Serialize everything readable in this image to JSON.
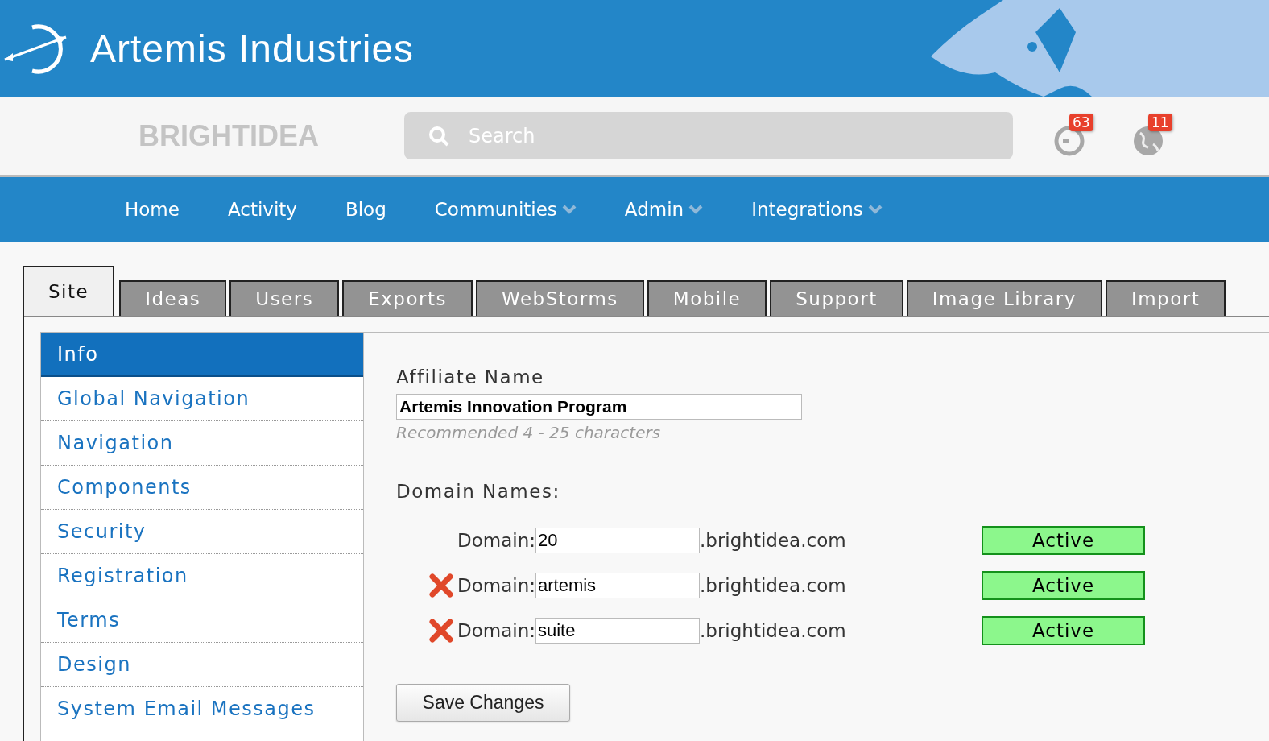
{
  "header": {
    "brand": "Artemis Industries"
  },
  "toolbar": {
    "logo_text": "BRIGHTIDEA",
    "search": {
      "placeholder": "Search"
    },
    "notifications": [
      {
        "kind": "clock",
        "count": "63"
      },
      {
        "kind": "globe",
        "count": "11"
      }
    ]
  },
  "nav": [
    {
      "label": "Home",
      "dropdown": false
    },
    {
      "label": "Activity",
      "dropdown": false
    },
    {
      "label": "Blog",
      "dropdown": false
    },
    {
      "label": "Communities",
      "dropdown": true
    },
    {
      "label": "Admin",
      "dropdown": true
    },
    {
      "label": "Integrations",
      "dropdown": true
    }
  ],
  "tabs": [
    {
      "label": "Site",
      "selected": true
    },
    {
      "label": "Ideas",
      "selected": false
    },
    {
      "label": "Users",
      "selected": false
    },
    {
      "label": "Exports",
      "selected": false
    },
    {
      "label": "WebStorms",
      "selected": false
    },
    {
      "label": "Mobile",
      "selected": false
    },
    {
      "label": "Support",
      "selected": false
    },
    {
      "label": "Image Library",
      "selected": false
    },
    {
      "label": "Import",
      "selected": false
    }
  ],
  "sidebar": {
    "items": [
      {
        "label": "Info",
        "selected": true
      },
      {
        "label": "Global Navigation",
        "selected": false
      },
      {
        "label": "Navigation",
        "selected": false
      },
      {
        "label": "Components",
        "selected": false
      },
      {
        "label": "Security",
        "selected": false
      },
      {
        "label": "Registration",
        "selected": false
      },
      {
        "label": "Terms",
        "selected": false
      },
      {
        "label": "Design",
        "selected": false
      },
      {
        "label": "System Email Messages",
        "selected": false
      }
    ]
  },
  "form": {
    "affiliate_label": "Affiliate Name",
    "affiliate_value": "Artemis Innovation Program",
    "affiliate_hint": "Recommended 4 - 25 characters",
    "domains_label": "Domain Names:",
    "domains": [
      {
        "removable": false,
        "label": "Domain:",
        "value": "20",
        "suffix": ".brightidea.com",
        "status": "Active"
      },
      {
        "removable": true,
        "label": "Domain:",
        "value": "artemis",
        "suffix": ".brightidea.com",
        "status": "Active"
      },
      {
        "removable": true,
        "label": "Domain:",
        "value": "suite",
        "suffix": ".brightidea.com",
        "status": "Active"
      }
    ],
    "save_button": "Save Changes"
  }
}
